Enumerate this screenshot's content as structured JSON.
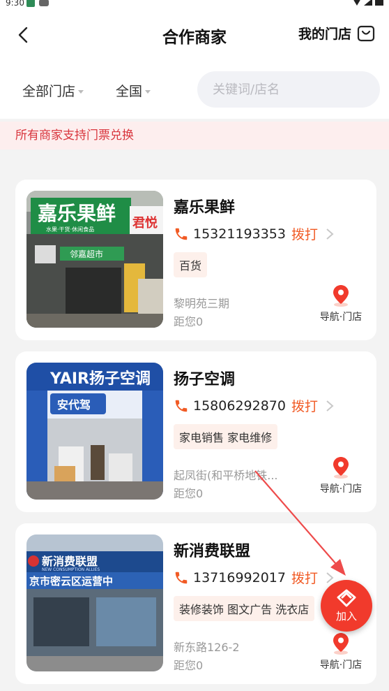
{
  "status_bar": {
    "time": "9:30"
  },
  "header": {
    "title": "合作商家",
    "my_store_label": "我的门店"
  },
  "filters": {
    "store_filter": "全部门店",
    "region_filter": "全国",
    "search_placeholder": "关键词/店名"
  },
  "notice": "所有商家支持门票兑换",
  "call_label": "拨打",
  "nav_label": "导航·门店",
  "stores": [
    {
      "name": "嘉乐果鲜",
      "phone": "15321193353",
      "tags": [
        "百货"
      ],
      "address": "黎明苑三期",
      "distance": "距您0",
      "photo_sign": "嘉乐果鲜",
      "photo_sign_sub": "水果·干货·休闲食品",
      "photo_side": "君悦",
      "photo_neighbor": "邻嘉超市"
    },
    {
      "name": "扬子空调",
      "phone": "15806292870",
      "tags": [
        "家电销售",
        "家电维修"
      ],
      "address": "起凤街(和平桥地铁...",
      "distance": "距您0",
      "photo_sign": "YAIR扬子空调",
      "photo_banner": "安代驾"
    },
    {
      "name": "新消费联盟",
      "phone": "13716992017",
      "tags": [
        "装修装饰",
        "图文广告",
        "洗衣店"
      ],
      "address": "新东路126-2",
      "distance": "距您0",
      "photo_sign": "新消费联盟",
      "photo_sign_en": "NEW CONSUMPTION ALLIES",
      "photo_sign_sub": "京市密云区运营中"
    }
  ],
  "join_button": {
    "label": "加入"
  },
  "colors": {
    "accent": "#f15a24",
    "fab": "#f13a2c",
    "notice_text": "#d9363e"
  }
}
